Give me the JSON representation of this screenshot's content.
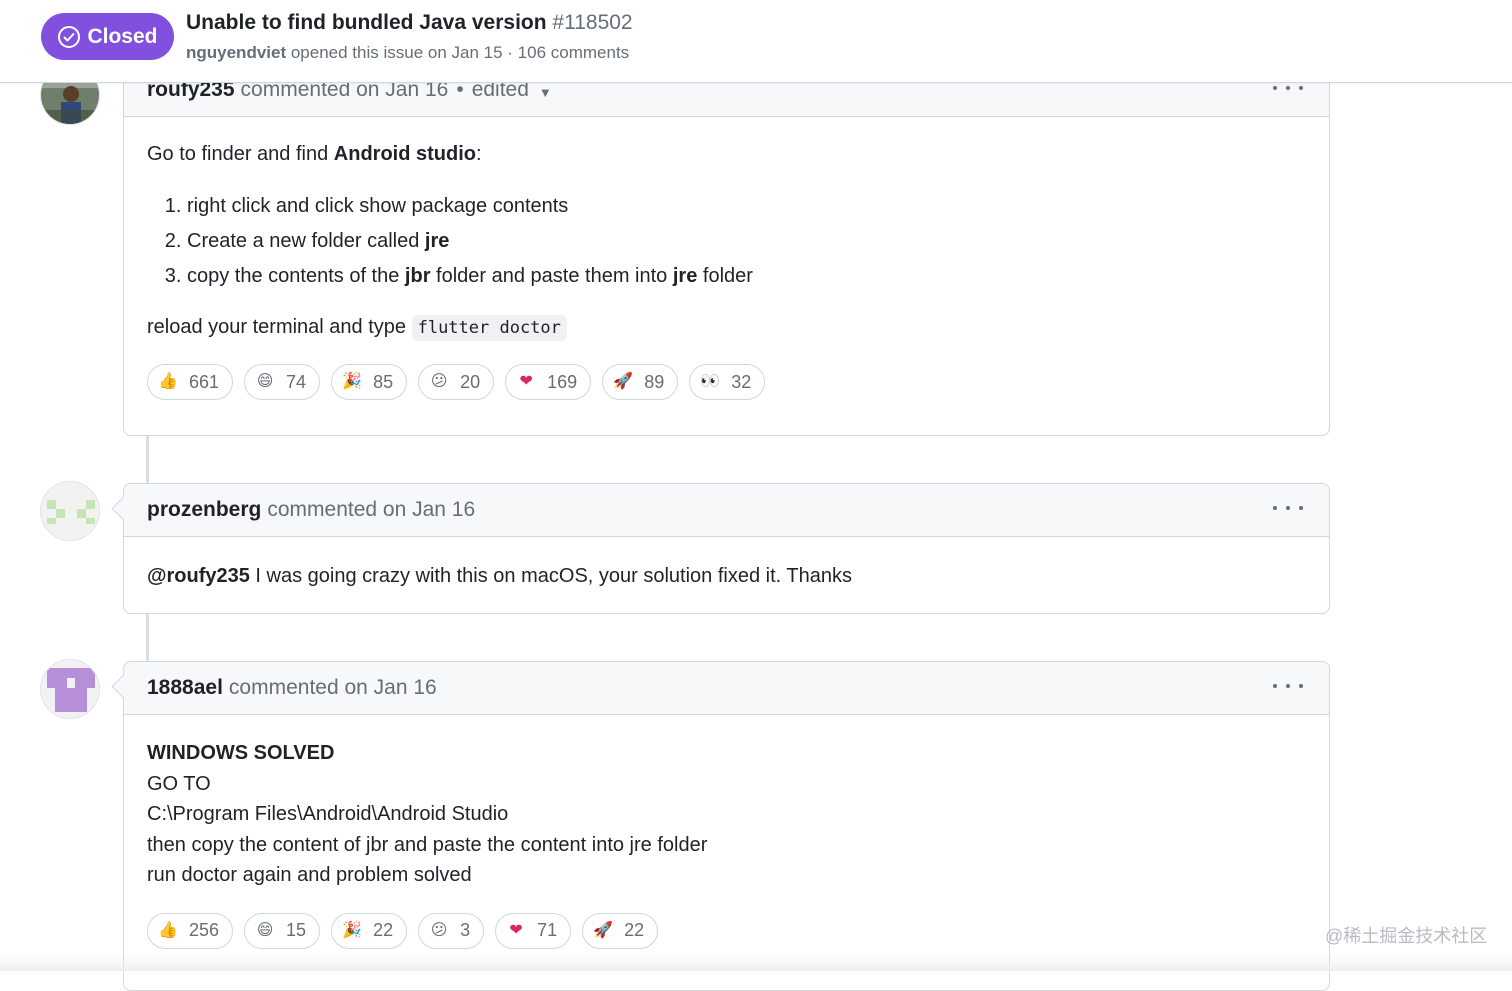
{
  "header": {
    "state_label": "Closed",
    "title": "Unable to find bundled Java version",
    "number": "#118502",
    "author": "nguyendviet",
    "meta_text": " opened this issue on Jan 15 · 106 comments",
    "accent_color": "#8250df"
  },
  "comments": [
    {
      "author": "roufy235",
      "action": "commented on Jan 16",
      "edited": "edited",
      "body": {
        "intro_pre": "Go to finder and find ",
        "intro_bold": "Android studio",
        "intro_post": ":",
        "steps": [
          {
            "pre": "right click and click show package contents",
            "bold": "",
            "mid": "",
            "bold2": "",
            "post": ""
          },
          {
            "pre": "Create a new folder called ",
            "bold": "jre",
            "mid": "",
            "bold2": "",
            "post": ""
          },
          {
            "pre": "copy the contents of the ",
            "bold": "jbr",
            "mid": " folder and paste them into ",
            "bold2": "jre",
            "post": " folder"
          }
        ],
        "outro": "reload your terminal and type ",
        "code": "flutter doctor"
      },
      "reactions": [
        {
          "icon": "thumbs-up-icon",
          "glyph": "👍",
          "count": "661"
        },
        {
          "icon": "laugh-icon",
          "glyph": "😄",
          "count": "74"
        },
        {
          "icon": "hooray-icon",
          "glyph": "🎉",
          "count": "85"
        },
        {
          "icon": "confused-icon",
          "glyph": "😕",
          "count": "20"
        },
        {
          "icon": "heart-icon",
          "glyph": "❤",
          "count": "169"
        },
        {
          "icon": "rocket-icon",
          "glyph": "🚀",
          "count": "89"
        },
        {
          "icon": "eyes-icon",
          "glyph": "👀",
          "count": "32"
        }
      ]
    },
    {
      "author": "prozenberg",
      "action": "commented on Jan 16",
      "body": {
        "mention": "@roufy235",
        "text": " I was going crazy with this on macOS, your solution fixed it. Thanks"
      }
    },
    {
      "author": "1888ael",
      "action": "commented on Jan 16",
      "body": {
        "lines": [
          "WINDOWS SOLVED",
          "GO TO",
          "C:\\Program Files\\Android\\Android Studio",
          "then copy the content of jbr and paste the content into jre folder",
          "run doctor again and problem solved"
        ]
      },
      "reactions": [
        {
          "icon": "thumbs-up-icon",
          "glyph": "👍",
          "count": "256"
        },
        {
          "icon": "laugh-icon",
          "glyph": "😄",
          "count": "15"
        },
        {
          "icon": "hooray-icon",
          "glyph": "🎉",
          "count": "22"
        },
        {
          "icon": "confused-icon",
          "glyph": "😕",
          "count": "3"
        },
        {
          "icon": "heart-icon",
          "glyph": "❤",
          "count": "71"
        },
        {
          "icon": "rocket-icon",
          "glyph": "🚀",
          "count": "22"
        }
      ]
    }
  ],
  "watermark": "@稀土掘金技术社区"
}
